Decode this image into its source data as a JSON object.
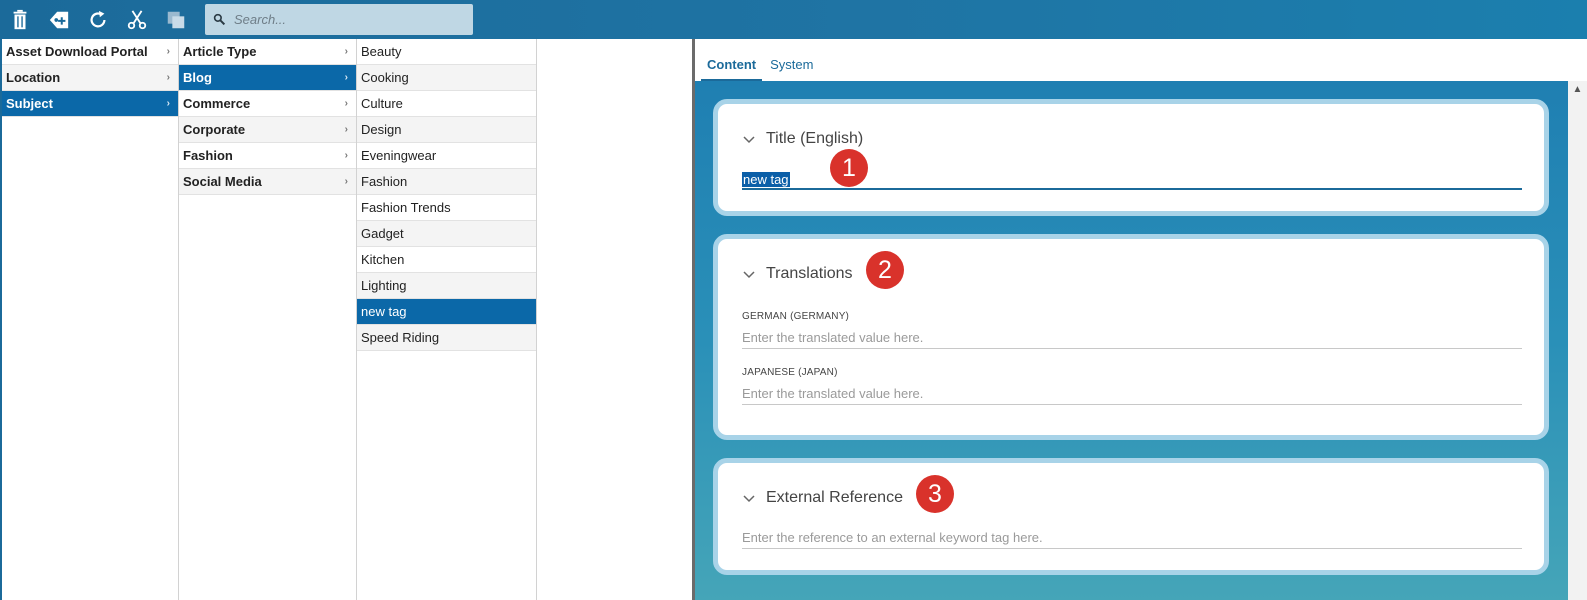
{
  "toolbar": {
    "buttons": [
      "trash-icon",
      "add-tag-icon",
      "refresh-icon",
      "cut-icon",
      "copy-icon"
    ],
    "search_placeholder": "Search..."
  },
  "columns": {
    "col1": [
      {
        "label": "Asset Download Portal",
        "selected": false
      },
      {
        "label": "Location",
        "selected": false
      },
      {
        "label": "Subject",
        "selected": true
      }
    ],
    "col2": [
      {
        "label": "Article Type",
        "selected": false
      },
      {
        "label": "Blog",
        "selected": true
      },
      {
        "label": "Commerce",
        "selected": false
      },
      {
        "label": "Corporate",
        "selected": false
      },
      {
        "label": "Fashion",
        "selected": false
      },
      {
        "label": "Social Media",
        "selected": false
      }
    ],
    "col3": [
      {
        "label": "Beauty",
        "selected": false
      },
      {
        "label": "Cooking",
        "selected": false
      },
      {
        "label": "Culture",
        "selected": false
      },
      {
        "label": "Design",
        "selected": false
      },
      {
        "label": "Eveningwear",
        "selected": false
      },
      {
        "label": "Fashion",
        "selected": false
      },
      {
        "label": "Fashion Trends",
        "selected": false
      },
      {
        "label": "Gadget",
        "selected": false
      },
      {
        "label": "Kitchen",
        "selected": false
      },
      {
        "label": "Lighting",
        "selected": false
      },
      {
        "label": "new tag",
        "selected": true
      },
      {
        "label": "Speed Riding",
        "selected": false
      }
    ]
  },
  "panel": {
    "tabs": [
      {
        "label": "Content",
        "active": true
      },
      {
        "label": "System",
        "active": false
      }
    ],
    "title_card": {
      "heading": "Title (English)",
      "badge": "1",
      "value": "new tag"
    },
    "translations_card": {
      "heading": "Translations",
      "badge": "2",
      "german_label": "GERMAN (GERMANY)",
      "german_placeholder": "Enter the translated value here.",
      "japanese_label": "JAPANESE (JAPAN)",
      "japanese_placeholder": "Enter the translated value here."
    },
    "external_card": {
      "heading": "External Reference",
      "badge": "3",
      "placeholder": "Enter the reference to an external keyword tag here."
    }
  },
  "colors": {
    "toolbar": "#1b6a9a",
    "selected_row": "#0b68a8",
    "badge": "#d9322b"
  }
}
